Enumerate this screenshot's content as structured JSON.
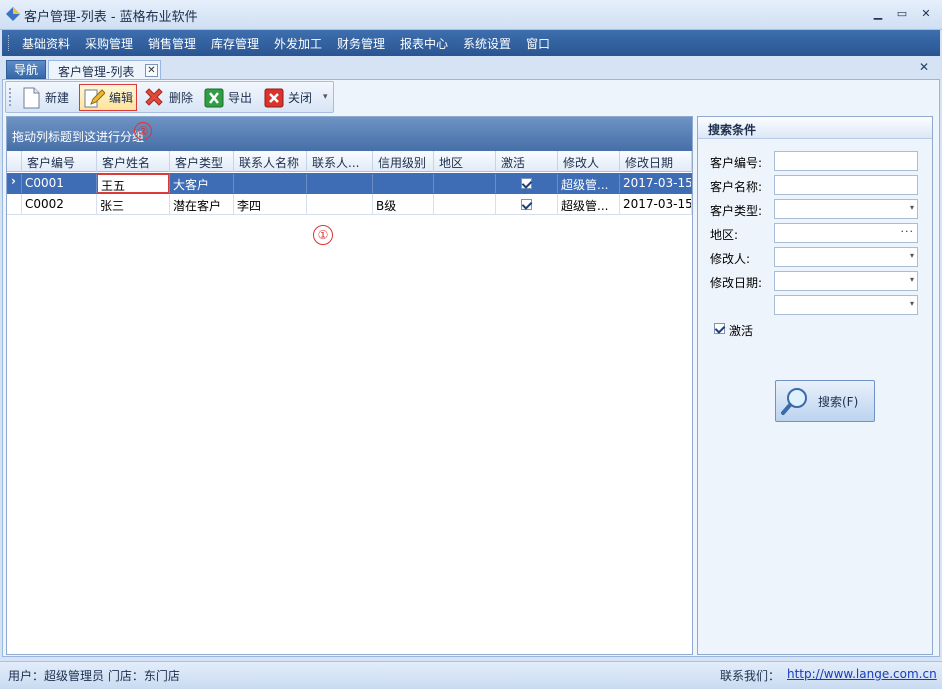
{
  "window": {
    "title": "客户管理-列表 - 蓝格布业软件",
    "minimize_glyph": "▁",
    "maximize_glyph": "▭",
    "close_glyph": "✕"
  },
  "menu": [
    "基础资料",
    "采购管理",
    "销售管理",
    "库存管理",
    "外发加工",
    "财务管理",
    "报表中心",
    "系统设置",
    "窗口"
  ],
  "tabs": {
    "nav": "导航",
    "customer": "客户管理-列表",
    "close_glyph": "✕",
    "main_close_glyph": "✕"
  },
  "toolbar": {
    "new": "新建",
    "edit": "编辑",
    "delete": "删除",
    "export": "导出",
    "close": "关闭",
    "dropdown_glyph": "▾"
  },
  "grid": {
    "group_hint": "拖动列标题到这进行分组",
    "columns": [
      "客户编号",
      "客户姓名",
      "客户类型",
      "联系人名称",
      "联系人...",
      "信用级别",
      "地区",
      "激活",
      "修改人",
      "修改日期"
    ],
    "row_indicator": "›",
    "rows": [
      {
        "code": "C0001",
        "name": "王五",
        "type": "大客户",
        "contact": "",
        "contact2": "",
        "credit": "",
        "region": "",
        "active": true,
        "modifier": "超级管...",
        "date": "2017-03-15"
      },
      {
        "code": "C0002",
        "name": "张三",
        "type": "潜在客户",
        "contact": "李四",
        "contact2": "",
        "credit": "B级",
        "region": "",
        "active": true,
        "modifier": "超级管...",
        "date": "2017-03-15"
      }
    ]
  },
  "annotations": {
    "marker1": "①",
    "marker2": "②"
  },
  "search": {
    "title": "搜索条件",
    "code_label": "客户编号:",
    "name_label": "客户名称:",
    "type_label": "客户类型:",
    "region_label": "地区:",
    "modifier_label": "修改人:",
    "date_label": "修改日期:",
    "active_label": "激活",
    "active_checked": true,
    "button_label": "搜索(F)",
    "arrow_glyph": "▾",
    "dots_glyph": "···"
  },
  "status": {
    "user": "用户：超级管理员  门店：东门店",
    "contact_label": "联系我们：",
    "link": "http://www.lange.com.cn"
  },
  "colors": {
    "menu_bg": "#2a5592",
    "selected_row": "#3f6db5",
    "highlight_red": "#d93b3b"
  }
}
